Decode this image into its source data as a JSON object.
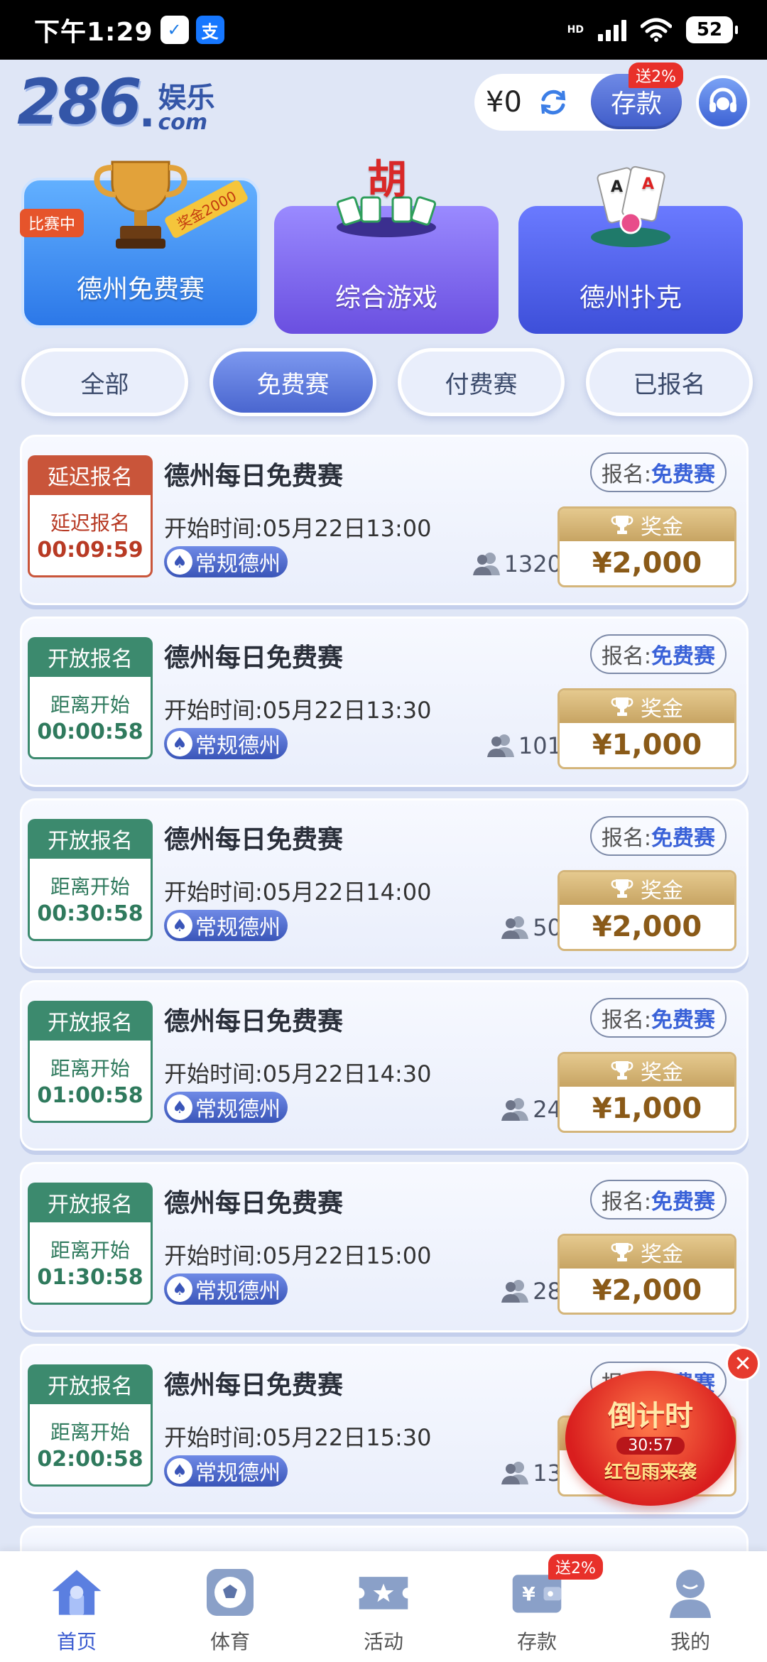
{
  "status_bar": {
    "time": "下午1:29",
    "app1": "✓",
    "app2": "支",
    "hd": "HD",
    "battery": "52"
  },
  "header": {
    "logo_num": "286",
    "logo_dot": ".",
    "logo_cn": "娱乐",
    "logo_com": "com",
    "balance": "¥0",
    "deposit_label": "存款",
    "deposit_badge": "送2%"
  },
  "games": [
    {
      "label": "德州免费赛",
      "tag": "比赛中",
      "ribbon": "奖金2000"
    },
    {
      "label": "综合游戏",
      "icon_text": "胡"
    },
    {
      "label": "德州扑克"
    }
  ],
  "tabs": [
    {
      "label": "全部",
      "active": false
    },
    {
      "label": "免费赛",
      "active": true
    },
    {
      "label": "付费赛",
      "active": false
    },
    {
      "label": "已报名",
      "active": false
    }
  ],
  "tournaments": [
    {
      "status": "延迟报名",
      "timer_label": "延迟报名",
      "timer": "00:09:59",
      "title": "德州每日免费赛",
      "start": "开始时间:05月22日13:00",
      "type": "常规德州",
      "players": "1320",
      "fee_label": "报名:",
      "fee_value": "免费赛",
      "prize_label": "奖金",
      "prize": "¥2,000"
    },
    {
      "status": "开放报名",
      "timer_label": "距离开始",
      "timer": "00:00:58",
      "title": "德州每日免费赛",
      "start": "开始时间:05月22日13:30",
      "type": "常规德州",
      "players": "101",
      "fee_label": "报名:",
      "fee_value": "免费赛",
      "prize_label": "奖金",
      "prize": "¥1,000"
    },
    {
      "status": "开放报名",
      "timer_label": "距离开始",
      "timer": "00:30:58",
      "title": "德州每日免费赛",
      "start": "开始时间:05月22日14:00",
      "type": "常规德州",
      "players": "50",
      "fee_label": "报名:",
      "fee_value": "免费赛",
      "prize_label": "奖金",
      "prize": "¥2,000"
    },
    {
      "status": "开放报名",
      "timer_label": "距离开始",
      "timer": "01:00:58",
      "title": "德州每日免费赛",
      "start": "开始时间:05月22日14:30",
      "type": "常规德州",
      "players": "24",
      "fee_label": "报名:",
      "fee_value": "免费赛",
      "prize_label": "奖金",
      "prize": "¥1,000"
    },
    {
      "status": "开放报名",
      "timer_label": "距离开始",
      "timer": "01:30:58",
      "title": "德州每日免费赛",
      "start": "开始时间:05月22日15:00",
      "type": "常规德州",
      "players": "28",
      "fee_label": "报名:",
      "fee_value": "免费赛",
      "prize_label": "奖金",
      "prize": "¥2,000"
    },
    {
      "status": "开放报名",
      "timer_label": "距离开始",
      "timer": "02:00:58",
      "title": "德州每日免费赛",
      "start": "开始时间:05月22日15:30",
      "type": "常规德州",
      "players": "13",
      "fee_label": "报名:",
      "fee_value": "免费赛",
      "prize_label": "",
      "prize": ""
    }
  ],
  "promo": {
    "title": "倒计时",
    "countdown": "30:57",
    "subtitle": "红包雨来袭",
    "close": "✕"
  },
  "bottom_nav": [
    {
      "label": "首页",
      "icon": "home-icon",
      "active": true
    },
    {
      "label": "体育",
      "icon": "soccer-ball-icon",
      "active": false
    },
    {
      "label": "活动",
      "icon": "ticket-icon",
      "active": false
    },
    {
      "label": "存款",
      "icon": "wallet-icon",
      "active": false,
      "badge": "送2%"
    },
    {
      "label": "我的",
      "icon": "profile-icon",
      "active": false
    }
  ],
  "colors": {
    "accent": "#3a5bd0",
    "late": "#c9553a",
    "open": "#3c8a6e",
    "prize_gold": "#c7a463",
    "badge_red": "#e8302a"
  }
}
